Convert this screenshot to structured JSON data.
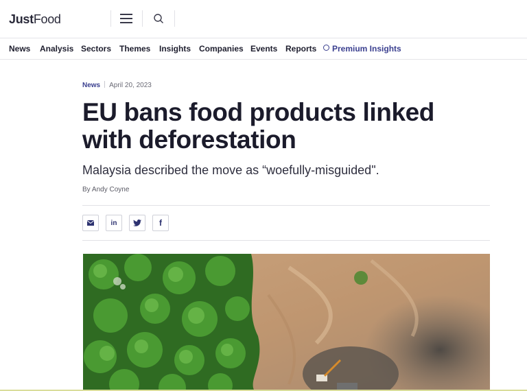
{
  "header": {
    "logo_just": "Just",
    "logo_food": "Food"
  },
  "nav": {
    "items": [
      "News",
      "Analysis",
      "Sectors",
      "Themes",
      "Insights",
      "Companies",
      "Events",
      "Reports"
    ],
    "premium": "Premium Insights"
  },
  "article": {
    "category": "News",
    "date": "April 20, 2023",
    "headline": "EU bans food products linked with deforestation",
    "standfirst": "Malaysia described the move as “woefully-misguided\".",
    "byline": "By Andy Coyne",
    "share": [
      "email-icon",
      "linkedin-icon",
      "twitter-icon",
      "facebook-icon"
    ],
    "share_labels": {
      "linkedin": "in",
      "facebook": "f"
    }
  },
  "colors": {
    "accent": "#3a3f8f",
    "text": "#1b1b2b",
    "forest": "#3f8a2a",
    "soil": "#c7a078"
  }
}
